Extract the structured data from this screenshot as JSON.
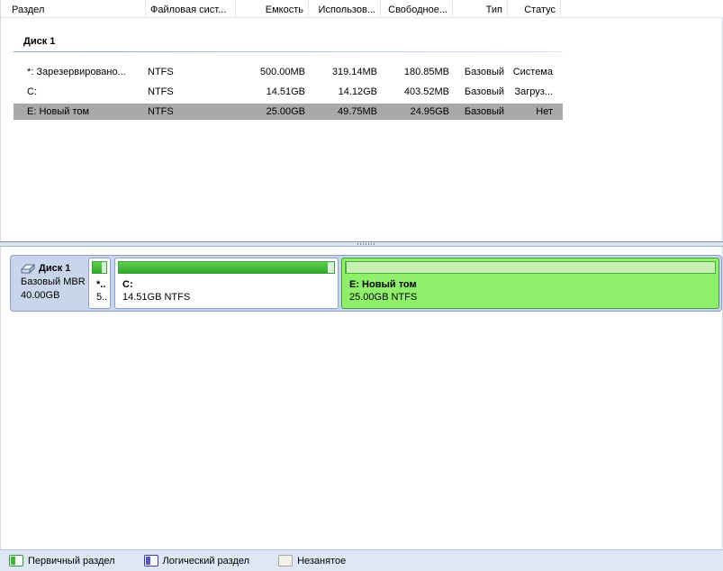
{
  "columns": {
    "partition": "Раздел",
    "filesystem": "Файловая сист...",
    "capacity": "Емкость",
    "used": "Использов...",
    "free": "Свободное...",
    "type": "Тип",
    "status": "Статус"
  },
  "table": {
    "disk_title": "Диск 1",
    "rows": [
      {
        "name": "*: Зарезервировано...",
        "fs": "NTFS",
        "capacity": "500.00MB",
        "used": "319.14MB",
        "free": "180.85MB",
        "type": "Базовый",
        "status": "Система",
        "selected": false
      },
      {
        "name": "C:",
        "fs": "NTFS",
        "capacity": "14.51GB",
        "used": "14.12GB",
        "free": "403.52MB",
        "type": "Базовый",
        "status": "Загруз...",
        "selected": false
      },
      {
        "name": "E: Новый том",
        "fs": "NTFS",
        "capacity": "25.00GB",
        "used": "49.75MB",
        "free": "24.95GB",
        "type": "Базовый",
        "status": "Нет",
        "selected": true
      }
    ]
  },
  "disk_map": {
    "disk_name": "Диск 1",
    "disk_type": "Базовый MBR",
    "disk_size": "40.00GB",
    "partitions": [
      {
        "label": "*..",
        "info": "5..",
        "used_fraction": 0.64
      },
      {
        "label": "C:",
        "info": "14.51GB NTFS",
        "used_fraction": 0.97
      },
      {
        "label": "E: Новый том",
        "info": "25.00GB NTFS",
        "used_fraction": 0.002
      }
    ]
  },
  "legend": {
    "primary": "Первичный раздел",
    "logical": "Логический раздел",
    "unallocated": "Незанятое"
  },
  "colors": {
    "primary_green": "#3ab53a",
    "selected_partition": "#90ef6a",
    "selected_row": "#a9a9a9",
    "logical_blue": "#5555cc"
  }
}
